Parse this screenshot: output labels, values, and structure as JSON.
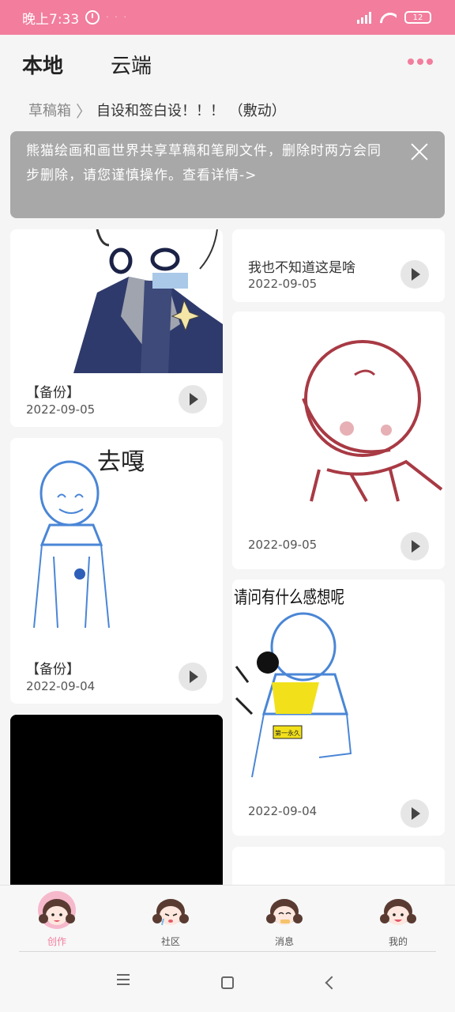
{
  "status_bar": {
    "time": "晚上7:33",
    "battery": "12"
  },
  "tabs": [
    {
      "label": "本地"
    },
    {
      "label": "云端"
    }
  ],
  "breadcrumb": {
    "root": "草稿箱",
    "separator": "〉",
    "current": "自设和签白设！！！ （敷动）"
  },
  "notice": {
    "text": "熊猫绘画和画世界共享草稿和笔刷文件，删除时两方会同步删除，请您谨慎操作。查看详情->"
  },
  "cards": [
    {
      "title": "【备份】",
      "date": "2022-09-05"
    },
    {
      "title": "我也不知道这是啥",
      "date": "2022-09-05"
    },
    {
      "title": "【备份】",
      "date": "2022-09-04"
    },
    {
      "title": "",
      "date": "2022-09-05"
    },
    {
      "title": "",
      "date": "2022-09-04"
    }
  ],
  "artwork_text": {
    "qu_ga": "去嘎",
    "ask": "请问有什么感想呢",
    "badge": "第一永久"
  },
  "bottom_nav": [
    {
      "label": "创作",
      "active": true
    },
    {
      "label": "社区"
    },
    {
      "label": "消息"
    },
    {
      "label": "我的"
    }
  ],
  "colors": {
    "accent": "#f27d9d",
    "notice_bg": "#a8a8a8"
  }
}
